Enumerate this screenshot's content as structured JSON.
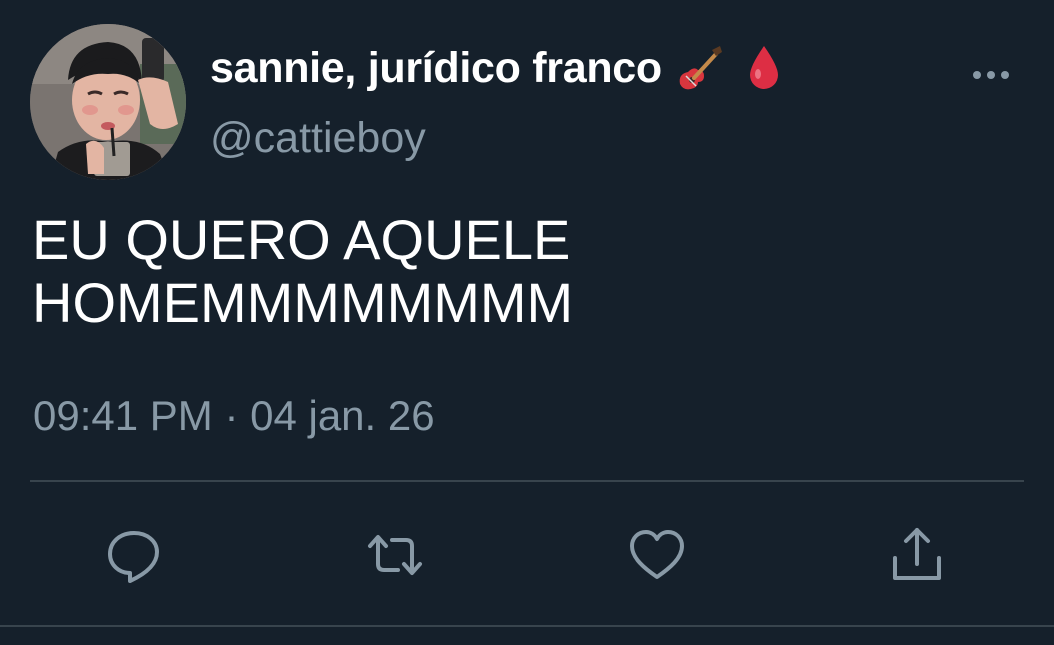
{
  "tweet": {
    "author": {
      "display_name": "sannie, jurídico franco",
      "name_emojis": [
        "guitar-emoji",
        "drop-of-blood-emoji"
      ],
      "handle": "@cattieboy",
      "avatar": "profile-photo"
    },
    "text": "EU QUERO AQUELE\nHOMEMMMMMMMM",
    "timestamp": "09:41 PM · 04 jan. 26",
    "actions": [
      "reply-icon",
      "retweet-icon",
      "like-icon",
      "share-icon"
    ],
    "more_icon": "more-horizontal-icon"
  },
  "colors": {
    "background": "#15202b",
    "primary_text": "#ffffff",
    "secondary_text": "#8899a6",
    "divider": "#38444d"
  }
}
